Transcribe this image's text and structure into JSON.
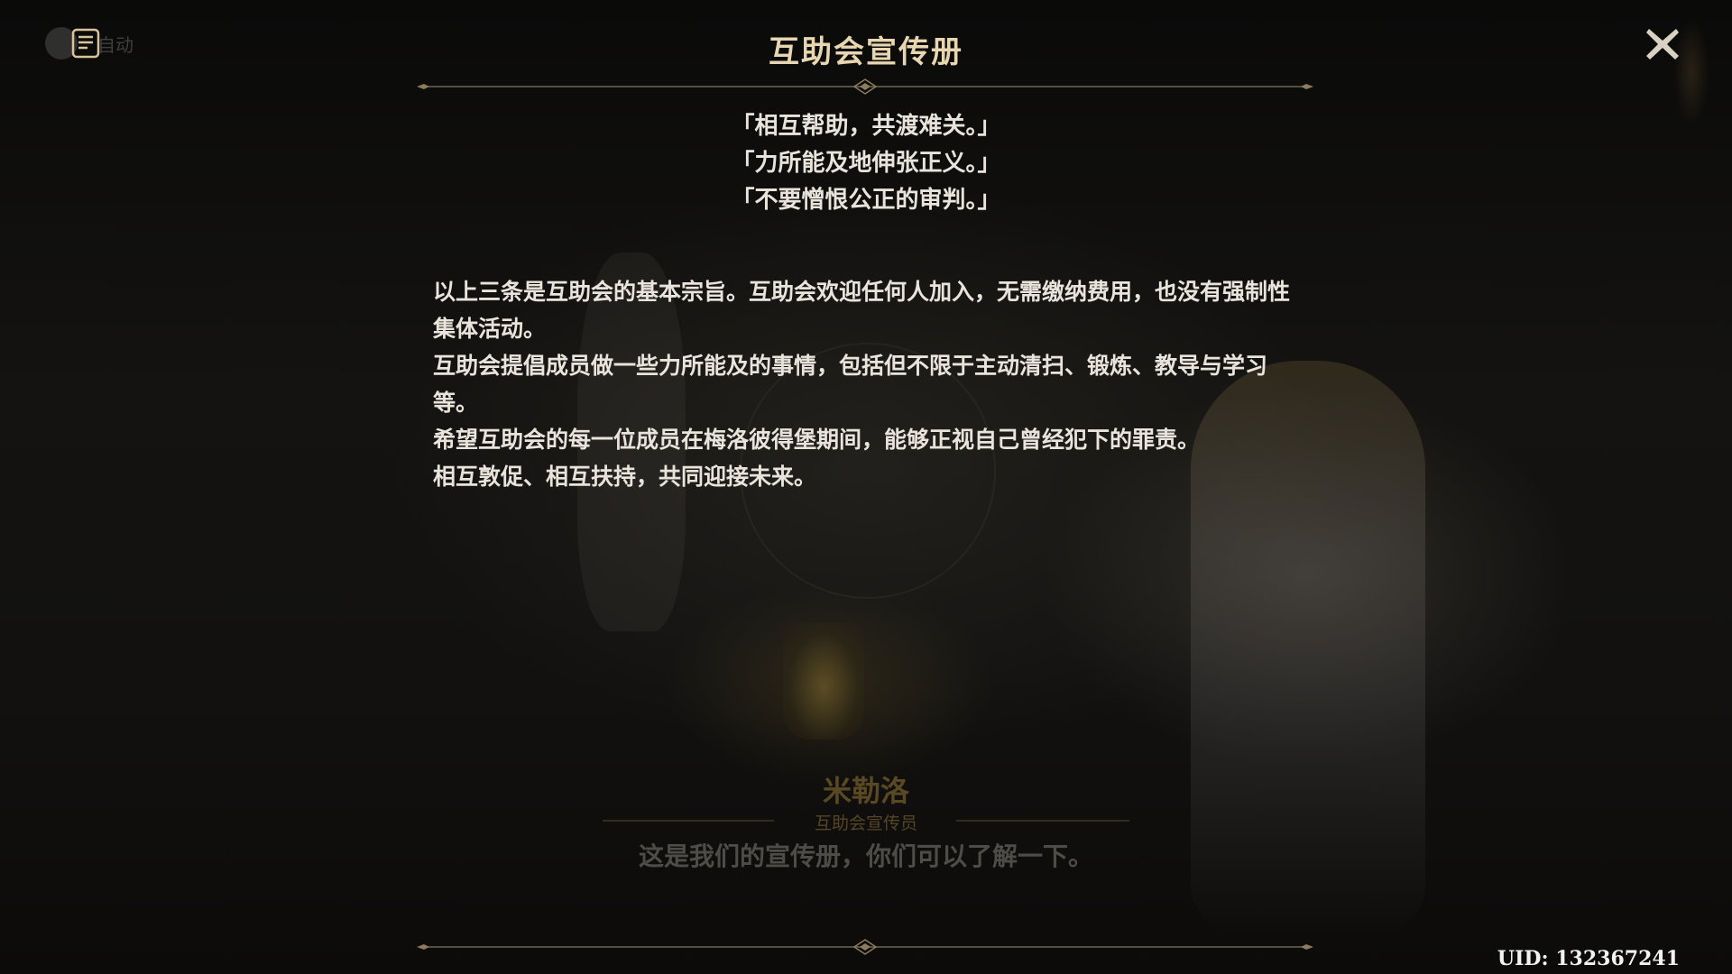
{
  "topbar": {
    "auto_label": "自动"
  },
  "book": {
    "title": "互助会宣传册",
    "mottos": [
      "「相互帮助，共渡难关。」",
      "「力所能及地伸张正义。」",
      "「不要憎恨公正的审判。」"
    ],
    "paragraphs": [
      "以上三条是互助会的基本宗旨。互助会欢迎任何人加入，无需缴纳费用，也没有强制性集体活动。",
      "互助会提倡成员做一些力所能及的事情，包括但不限于主动清扫、锻炼、教导与学习等。",
      "希望互助会的每一位成员在梅洛彼得堡期间，能够正视自己曾经犯下的罪责。",
      "相互敦促、相互扶持，共同迎接未来。"
    ]
  },
  "dialogue": {
    "speaker": "米勒洛",
    "speaker_role": "互助会宣传员",
    "line": "这是我们的宣传册，你们可以了解一下。"
  },
  "footer": {
    "uid": "UID: 132367241"
  },
  "colors": {
    "title": "#e7d6b0",
    "text": "#e8e4dc",
    "divider": "#8c7b5c",
    "accent": "#c9a865"
  }
}
